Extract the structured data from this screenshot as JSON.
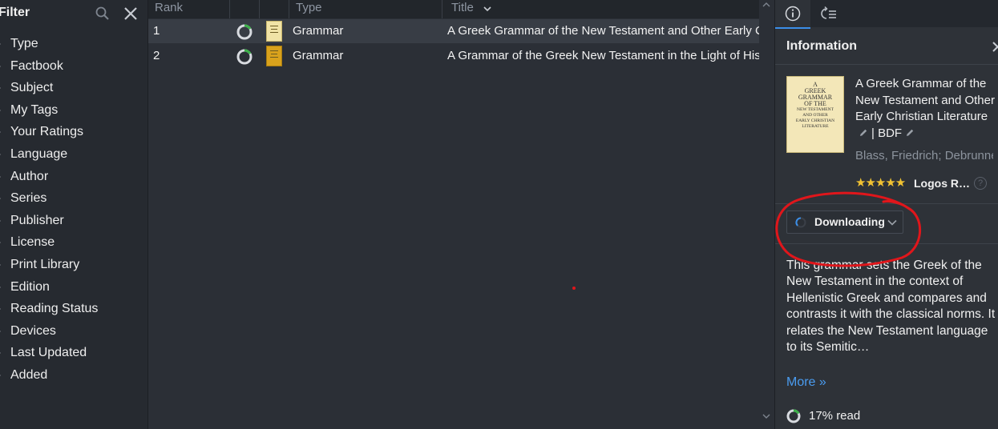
{
  "filter": {
    "title": "Filter",
    "items": [
      "Type",
      "Factbook",
      "Subject",
      "My Tags",
      "Your Ratings",
      "Language",
      "Author",
      "Series",
      "Publisher",
      "License",
      "Print Library",
      "Edition",
      "Reading Status",
      "Devices",
      "Last Updated",
      "Added"
    ]
  },
  "table": {
    "headers": {
      "rank": "Rank",
      "type": "Type",
      "title": "Title"
    },
    "rows": [
      {
        "rank": "1",
        "type": "Grammar",
        "title": "A Greek Grammar of the New Testament and Other Early Christian Literature",
        "selected": true,
        "progress": 0.17
      },
      {
        "rank": "2",
        "type": "Grammar",
        "title": "A Grammar of the Greek New Testament in the Light of Historical Research",
        "selected": false,
        "progress": 0.17
      }
    ]
  },
  "info": {
    "title": "Information",
    "book_title": "A Greek Grammar of the New Testament and Other Early Christian Literature",
    "abbrev": "| BDF",
    "author": "Blass, Friedrich; Debrunner, Albert",
    "stars": "★★★★★",
    "rating_source": "Logos R…",
    "help": "?",
    "download_label": "Downloading",
    "description": "This grammar sets the Greek of the New Testament in the context of Hellenistic Greek and compares and contrasts it with the classical norms. It relates the New Testament language to its Semitic…",
    "more": "More »",
    "read_label": "17% read",
    "read_fraction": 0.17,
    "cover": {
      "lines": [
        "A",
        "GREEK",
        "GRAMMAR",
        "OF THE",
        "NEW TESTAMENT",
        "AND OTHER",
        "EARLY CHRISTIAN",
        "LITERATURE"
      ]
    }
  },
  "colors": {
    "accent": "#3b8ee8",
    "link": "#4a9cf0",
    "star": "#f1c232",
    "annotation": "#e0161b"
  }
}
